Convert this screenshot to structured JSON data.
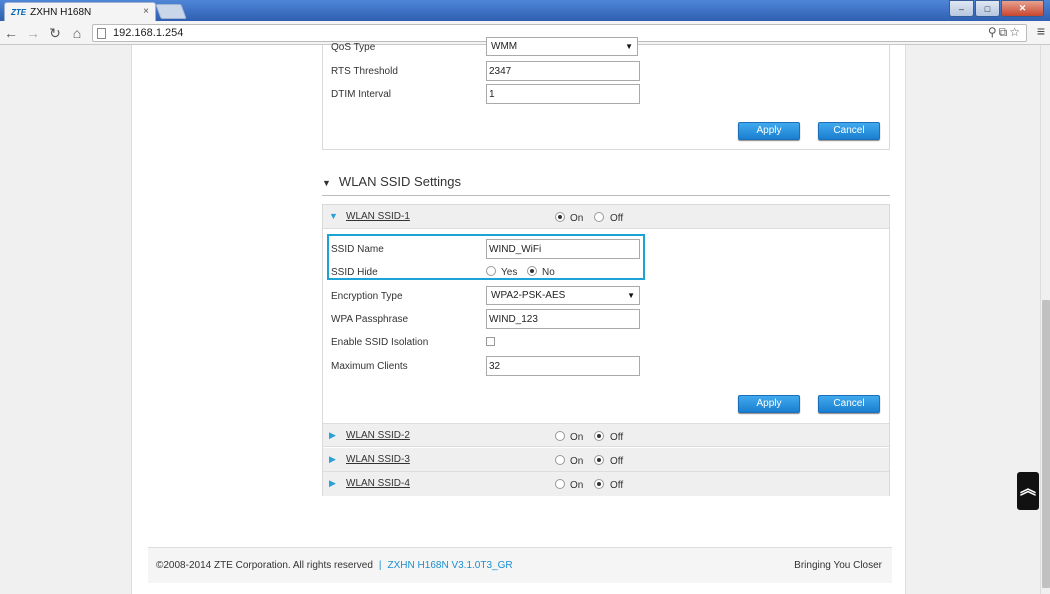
{
  "browser": {
    "tab_title": "ZXHN H168N",
    "tab_favicon": "ZTE",
    "tab_close": "×",
    "url": "192.168.1.254",
    "window_buttons": {
      "minimize": "‒",
      "maximize": "□",
      "close": "✕"
    },
    "nav": {
      "back": "←",
      "forward": "→",
      "reload": "↻",
      "home": "⌂"
    },
    "url_tools": "⚲⧉☆",
    "menu": "≡"
  },
  "top_panel": {
    "qos_label": "QoS Type",
    "qos_value": "WMM",
    "rts_label": "RTS Threshold",
    "rts_value": "2347",
    "dtim_label": "DTIM Interval",
    "dtim_value": "1",
    "apply_label": "Apply",
    "cancel_label": "Cancel"
  },
  "ssid_section": {
    "title": "WLAN SSID Settings",
    "on_label": "On",
    "off_label": "Off",
    "ssid1": {
      "name": "WLAN SSID-1",
      "state": "on",
      "ssid_name_label": "SSID Name",
      "ssid_name_value": "WIND_WiFi",
      "ssid_hide_label": "SSID Hide",
      "yes_label": "Yes",
      "no_label": "No",
      "hide_selected": "no",
      "encryption_label": "Encryption Type",
      "encryption_value": "WPA2-PSK-AES",
      "passphrase_label": "WPA Passphrase",
      "passphrase_value": "WIND_123",
      "isolation_label": "Enable SSID Isolation",
      "isolation_checked": false,
      "max_clients_label": "Maximum Clients",
      "max_clients_value": "32",
      "apply_label": "Apply",
      "cancel_label": "Cancel"
    },
    "ssid2": {
      "name": "WLAN SSID-2",
      "state": "off"
    },
    "ssid3": {
      "name": "WLAN SSID-3",
      "state": "off"
    },
    "ssid4": {
      "name": "WLAN SSID-4",
      "state": "off"
    }
  },
  "footer": {
    "copyright": "©2008-2014 ZTE Corporation. All rights reserved",
    "separator": "|",
    "version": "ZXHN H168N V3.1.0T3_GR",
    "slogan": "Bringing You Closer"
  },
  "back_to_top": "︽",
  "colors": {
    "accent": "#1aa3d4",
    "button": "#1a7fd0",
    "link": "#1a8fcf"
  }
}
